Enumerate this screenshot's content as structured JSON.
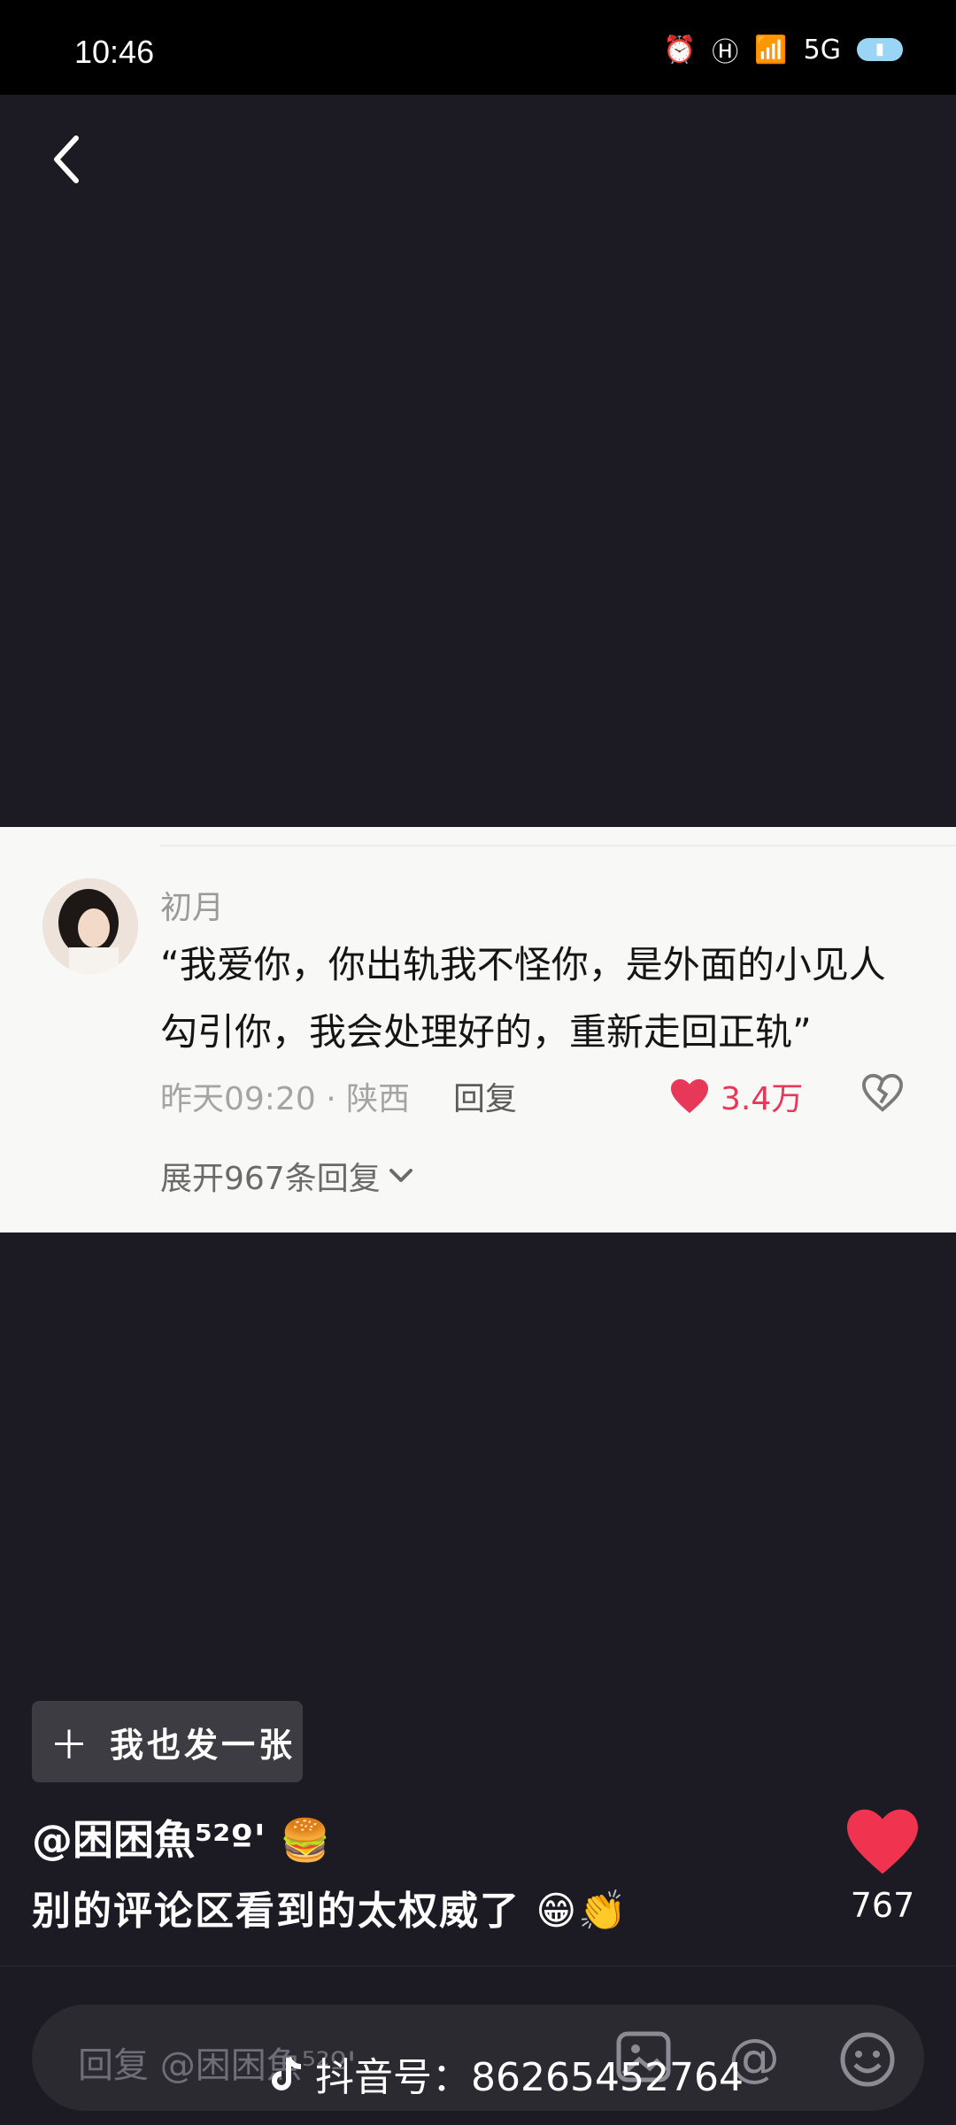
{
  "status": {
    "time": "10:46",
    "network": "5G"
  },
  "comment": {
    "username": "初月",
    "text": "“我爱你，你出轨我不怪你，是外面的小见人勾引你，我会处理好的，重新走回正轨”",
    "time_location": "昨天09:20 · 陕西",
    "reply_label": "回复",
    "like_count": "3.4万",
    "expand_label": "展开967条回复",
    "colors": {
      "like": "#e8385a"
    }
  },
  "post": {
    "button_label": "我也发一张",
    "author": "@困困魚⁵²º'",
    "caption": "别的评论区看到的太权威了",
    "like_count": "767"
  },
  "input": {
    "placeholder": "回复 @困困魚⁵²º'",
    "watermark": "抖音号：86265452764"
  }
}
